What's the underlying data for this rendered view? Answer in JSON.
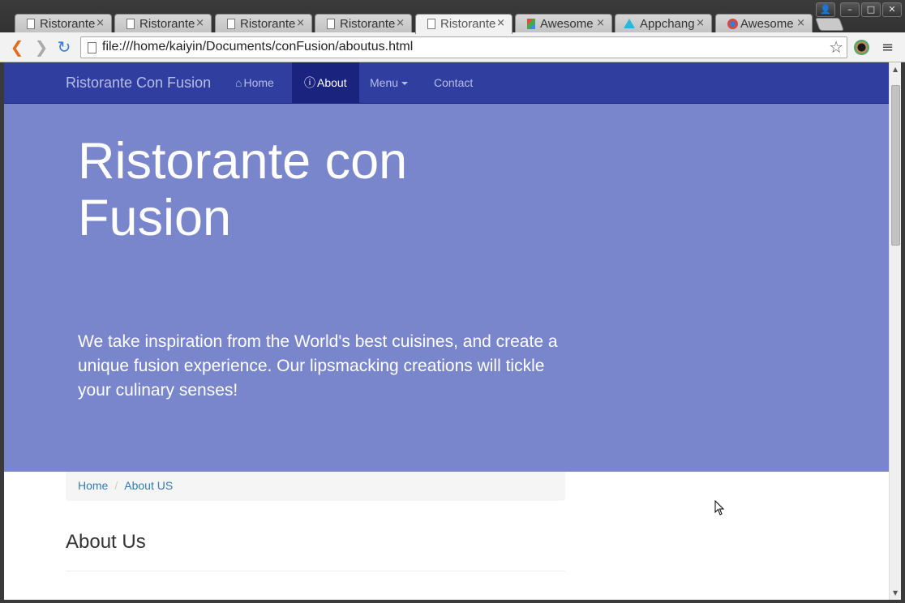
{
  "browser": {
    "tabs": [
      {
        "title": "Ristorante",
        "icon": "page-icon",
        "active": false
      },
      {
        "title": "Ristorante",
        "icon": "page-icon",
        "active": false
      },
      {
        "title": "Ristorante",
        "icon": "page-icon",
        "active": false
      },
      {
        "title": "Ristorante",
        "icon": "page-icon",
        "active": false
      },
      {
        "title": "Ristorante",
        "icon": "page-icon",
        "active": true
      },
      {
        "title": "Awesome",
        "icon": "chrome-store-icon",
        "active": false
      },
      {
        "title": "Appchang",
        "icon": "appchanger-icon",
        "active": false
      },
      {
        "title": "Awesome",
        "icon": "chrome-icon",
        "active": false
      }
    ],
    "close_glyph": "×",
    "url": "file:///home/kaiyin/Documents/conFusion/aboutus.html",
    "back_glyph": "❮",
    "forward_glyph": "❯",
    "reload_glyph": "↻",
    "star_glyph": "☆",
    "menu_glyph": "≡"
  },
  "site": {
    "brand": "Ristorante Con Fusion",
    "nav": {
      "home": "Home",
      "about": "About",
      "menu": "Menu",
      "contact": "Contact"
    },
    "jumbotron": {
      "title": "Ristorante con Fusion",
      "lead": "We take inspiration from the World's best cuisines, and create a unique fusion experience. Our lipsmacking creations will tickle your culinary senses!"
    },
    "breadcrumb": {
      "home": "Home",
      "separator": "/",
      "current": "About US"
    },
    "page_heading": "About Us"
  },
  "colors": {
    "navbar": "#303f9f",
    "navbar_active": "#1a237e",
    "jumbotron": "#7986cb",
    "link": "#337ab7"
  }
}
